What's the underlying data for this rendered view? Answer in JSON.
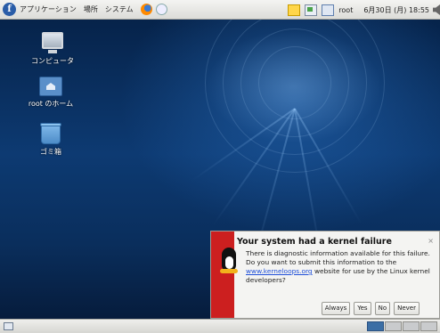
{
  "top_panel": {
    "menus": [
      "アプリケーション",
      "場所",
      "システム"
    ],
    "user": "root",
    "clock": "6月30日 (月) 18:55"
  },
  "desktop": {
    "icons": [
      {
        "label": "コンピュータ",
        "icon": "computer-icon"
      },
      {
        "label": "root のホーム",
        "icon": "home-folder-icon"
      },
      {
        "label": "ゴミ箱",
        "icon": "trash-icon"
      }
    ]
  },
  "notification": {
    "title": "Your system had a kernel failure",
    "body_before": "There is diagnostic information available for this failure. Do you want to submit this information to the ",
    "link": "www.kerneloops.org",
    "body_after": " website for use by the Linux kernel developers?",
    "close_label": "×",
    "buttons": [
      "Always",
      "Yes",
      "No",
      "Never"
    ],
    "accent_color": "#cc1f1f"
  },
  "bottom_panel": {
    "workspaces": 4,
    "active_workspace": 1
  }
}
